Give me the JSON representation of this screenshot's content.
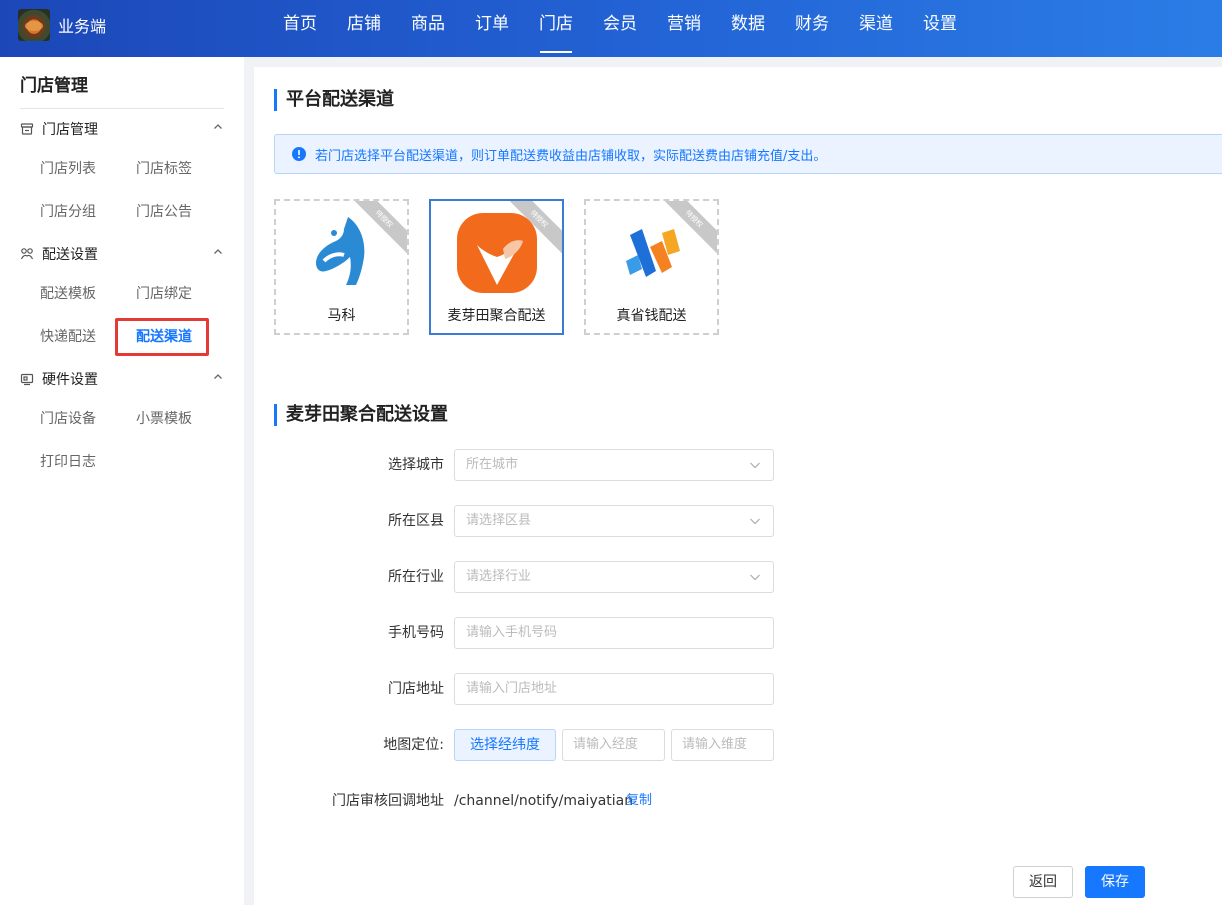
{
  "brand": {
    "name": "业务端"
  },
  "nav": [
    "首页",
    "店铺",
    "商品",
    "订单",
    "门店",
    "会员",
    "营销",
    "数据",
    "财务",
    "渠道",
    "设置"
  ],
  "nav_active_index": 4,
  "sidebar": {
    "title": "门店管理",
    "groups": [
      {
        "label": "门店管理",
        "icon": "store-icon",
        "items": [
          "门店列表",
          "门店标签",
          "门店分组",
          "门店公告"
        ]
      },
      {
        "label": "配送设置",
        "icon": "delivery-icon",
        "items": [
          "配送模板",
          "门店绑定",
          "快递配送",
          "配送渠道"
        ]
      },
      {
        "label": "硬件设置",
        "icon": "hardware-icon",
        "items": [
          "门店设备",
          "小票模板",
          "打印日志"
        ]
      }
    ],
    "active_item": "配送渠道"
  },
  "platform": {
    "title": "平台配送渠道",
    "notice": "若门店选择平台配送渠道，则订单配送费收益由店铺收取，实际配送费由店铺充值/支出。",
    "channels": [
      {
        "name": "马科",
        "badge": "待授权",
        "selected": false
      },
      {
        "name": "麦芽田聚合配送",
        "badge": "待授权",
        "selected": true
      },
      {
        "name": "真省钱配送",
        "badge": "待授权",
        "selected": false
      }
    ]
  },
  "settings": {
    "title": "麦芽田聚合配送设置",
    "fields": {
      "city": {
        "label": "选择城市",
        "placeholder": "所在城市"
      },
      "district": {
        "label": "所在区县",
        "placeholder": "请选择区县"
      },
      "industry": {
        "label": "所在行业",
        "placeholder": "请选择行业"
      },
      "phone": {
        "label": "手机号码",
        "placeholder": "请输入手机号码"
      },
      "address": {
        "label": "门店地址",
        "placeholder": "请输入门店地址"
      },
      "location": {
        "label": "地图定位:",
        "button": "选择经纬度",
        "lng_placeholder": "请输入经度",
        "lat_placeholder": "请输入维度"
      },
      "callback": {
        "label": "门店审核回调地址",
        "value": "/channel/notify/maiyatian",
        "copy": "复制"
      }
    }
  },
  "actions": {
    "back": "返回",
    "save": "保存"
  },
  "colors": {
    "primary": "#1677ff",
    "highlight": "#e53935",
    "nav_start": "#1c47b8",
    "nav_end": "#2b7de6"
  }
}
